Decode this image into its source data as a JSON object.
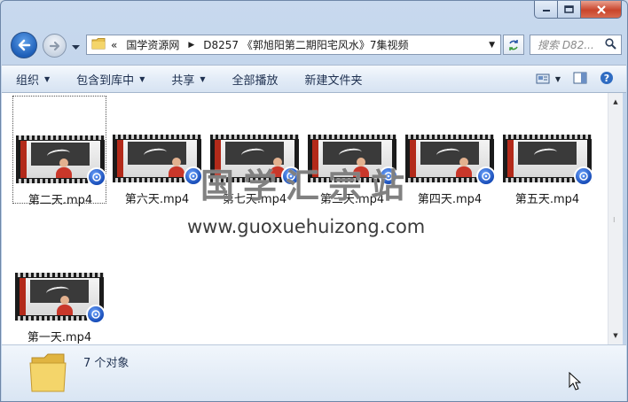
{
  "window": {
    "caption_buttons": {
      "minimize": "minimize-icon",
      "maximize": "maximize-icon",
      "close": "close-icon"
    }
  },
  "navigation": {
    "breadcrumbs": [
      "«",
      "国学资源网",
      "D8257 《郭旭阳第二期阳宅风水》7集视频"
    ],
    "search_placeholder": "搜索 D82..."
  },
  "toolbar": {
    "items": [
      {
        "label": "组织",
        "dropdown": true
      },
      {
        "label": "包含到库中",
        "dropdown": true
      },
      {
        "label": "共享",
        "dropdown": true
      },
      {
        "label": "全部播放",
        "dropdown": false
      },
      {
        "label": "新建文件夹",
        "dropdown": false
      }
    ]
  },
  "files": [
    {
      "name": "第二天.mp4",
      "selected": true
    },
    {
      "name": "第六天.mp4",
      "selected": false
    },
    {
      "name": "第七天.mp4",
      "selected": false
    },
    {
      "name": "第三天.mp4",
      "selected": false
    },
    {
      "name": "第四天.mp4",
      "selected": false
    },
    {
      "name": "第五天.mp4",
      "selected": false
    },
    {
      "name": "第一天.mp4",
      "selected": false
    }
  ],
  "watermark": {
    "text": "国学汇宗站",
    "url": "www.guoxuehuizong.com"
  },
  "status": {
    "count_text": "7 个对象"
  },
  "colors": {
    "accent": "#1e5fb8",
    "close_button": "#c9452c",
    "toolbar_text": "#1e3050"
  }
}
